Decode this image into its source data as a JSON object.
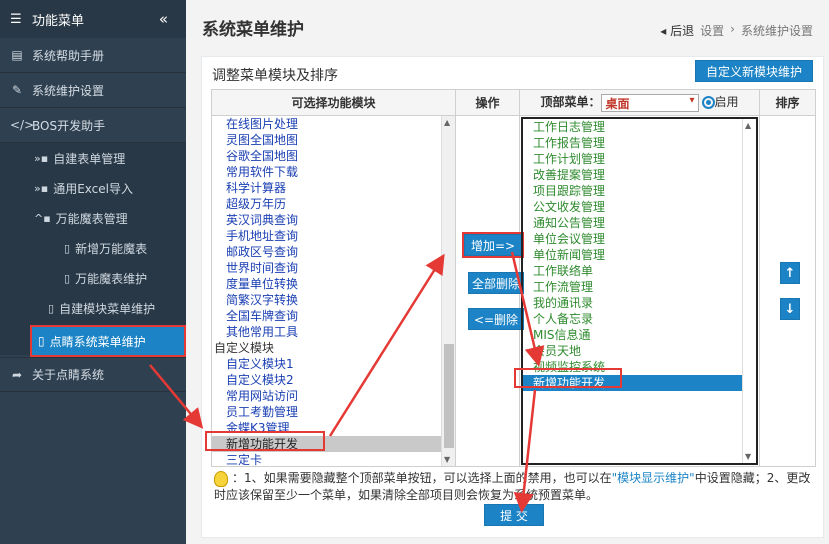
{
  "sidebar": {
    "header": "功能菜单",
    "collapse_icon": "«",
    "items": [
      {
        "label": "系统帮助手册",
        "icon": "book-icon"
      },
      {
        "label": "系统维护设置",
        "icon": "wrench-icon"
      },
      {
        "label": "BOS开发助手",
        "icon": "code-icon"
      }
    ],
    "sub": [
      {
        "label": "自建表单管理"
      },
      {
        "label": "通用Excel导入"
      },
      {
        "label": "万能魔表管理"
      }
    ],
    "sub2": [
      {
        "label": "新增万能魔表"
      },
      {
        "label": "万能魔表维护"
      }
    ],
    "sub_more": {
      "label": "自建模块菜单维护"
    },
    "active": {
      "label": "点睛系统菜单维护"
    },
    "about": {
      "label": "关于点睛系统"
    }
  },
  "page": {
    "title": "系统菜单维护",
    "breadcrumb": {
      "back": "后退",
      "level1": "设置",
      "level2": "系统维护设置"
    }
  },
  "panel": {
    "title": "调整菜单模块及排序",
    "custom_button": "自定义新模块维护",
    "headers": {
      "available": "可选择功能模块",
      "op": "操作",
      "top_menu": "顶部菜单：",
      "enable": "启用",
      "sort": "排序"
    },
    "top_menu_selected": "桌面",
    "left_list": [
      {
        "label": "在线图片处理"
      },
      {
        "label": "灵图全国地图"
      },
      {
        "label": "谷歌全国地图"
      },
      {
        "label": "常用软件下载"
      },
      {
        "label": "科学计算器"
      },
      {
        "label": "超级万年历"
      },
      {
        "label": "英汉词典查询"
      },
      {
        "label": "手机地址查询"
      },
      {
        "label": "邮政区号查询"
      },
      {
        "label": "世界时间查询"
      },
      {
        "label": "度量单位转换"
      },
      {
        "label": "简繁汉字转换"
      },
      {
        "label": "全国车牌查询"
      },
      {
        "label": "其他常用工具"
      },
      {
        "label": "自定义模块",
        "group": true
      },
      {
        "label": "自定义模块1"
      },
      {
        "label": "自定义模块2"
      },
      {
        "label": "常用网站访问"
      },
      {
        "label": "员工考勤管理"
      },
      {
        "label": "金蝶K3管理"
      },
      {
        "label": "新增功能开发",
        "selected": true
      },
      {
        "label": "三定卡"
      }
    ],
    "right_list": [
      {
        "label": "工作日志管理"
      },
      {
        "label": "工作报告管理"
      },
      {
        "label": "工作计划管理"
      },
      {
        "label": "改善提案管理"
      },
      {
        "label": "项目跟踪管理"
      },
      {
        "label": "公文收发管理"
      },
      {
        "label": "通知公告管理"
      },
      {
        "label": "单位会议管理"
      },
      {
        "label": "单位新闻管理"
      },
      {
        "label": "工作联络单"
      },
      {
        "label": "工作流管理"
      },
      {
        "label": "我的通讯录"
      },
      {
        "label": "个人备忘录"
      },
      {
        "label": "MIS信息通"
      },
      {
        "label": "会员天地"
      },
      {
        "label": "视频监控系统"
      },
      {
        "label": "新增功能开发",
        "selected": true
      }
    ],
    "ops": {
      "add": "增加=>",
      "remove_all": "全部删除",
      "remove": "<=删除"
    },
    "sort": {
      "up": "↑",
      "down": "↓"
    },
    "hint": {
      "prefix": "：1、如果需要隐藏整个顶部菜单按钮，可以选择上面的禁用，也可以在",
      "link": "\"模块显示维护\"",
      "suffix": "中设置隐藏；2、更改时应该保留至少一个菜单，如果清除全部项目则会恢复为系统预置菜单。"
    },
    "submit": "提 交"
  },
  "colors": {
    "sidebar_bg": "#2f4050",
    "accent": "#1c84c6",
    "highlight": "#e53935",
    "module_link": "#1a3fb3",
    "menu_item": "#2e8b2e"
  }
}
